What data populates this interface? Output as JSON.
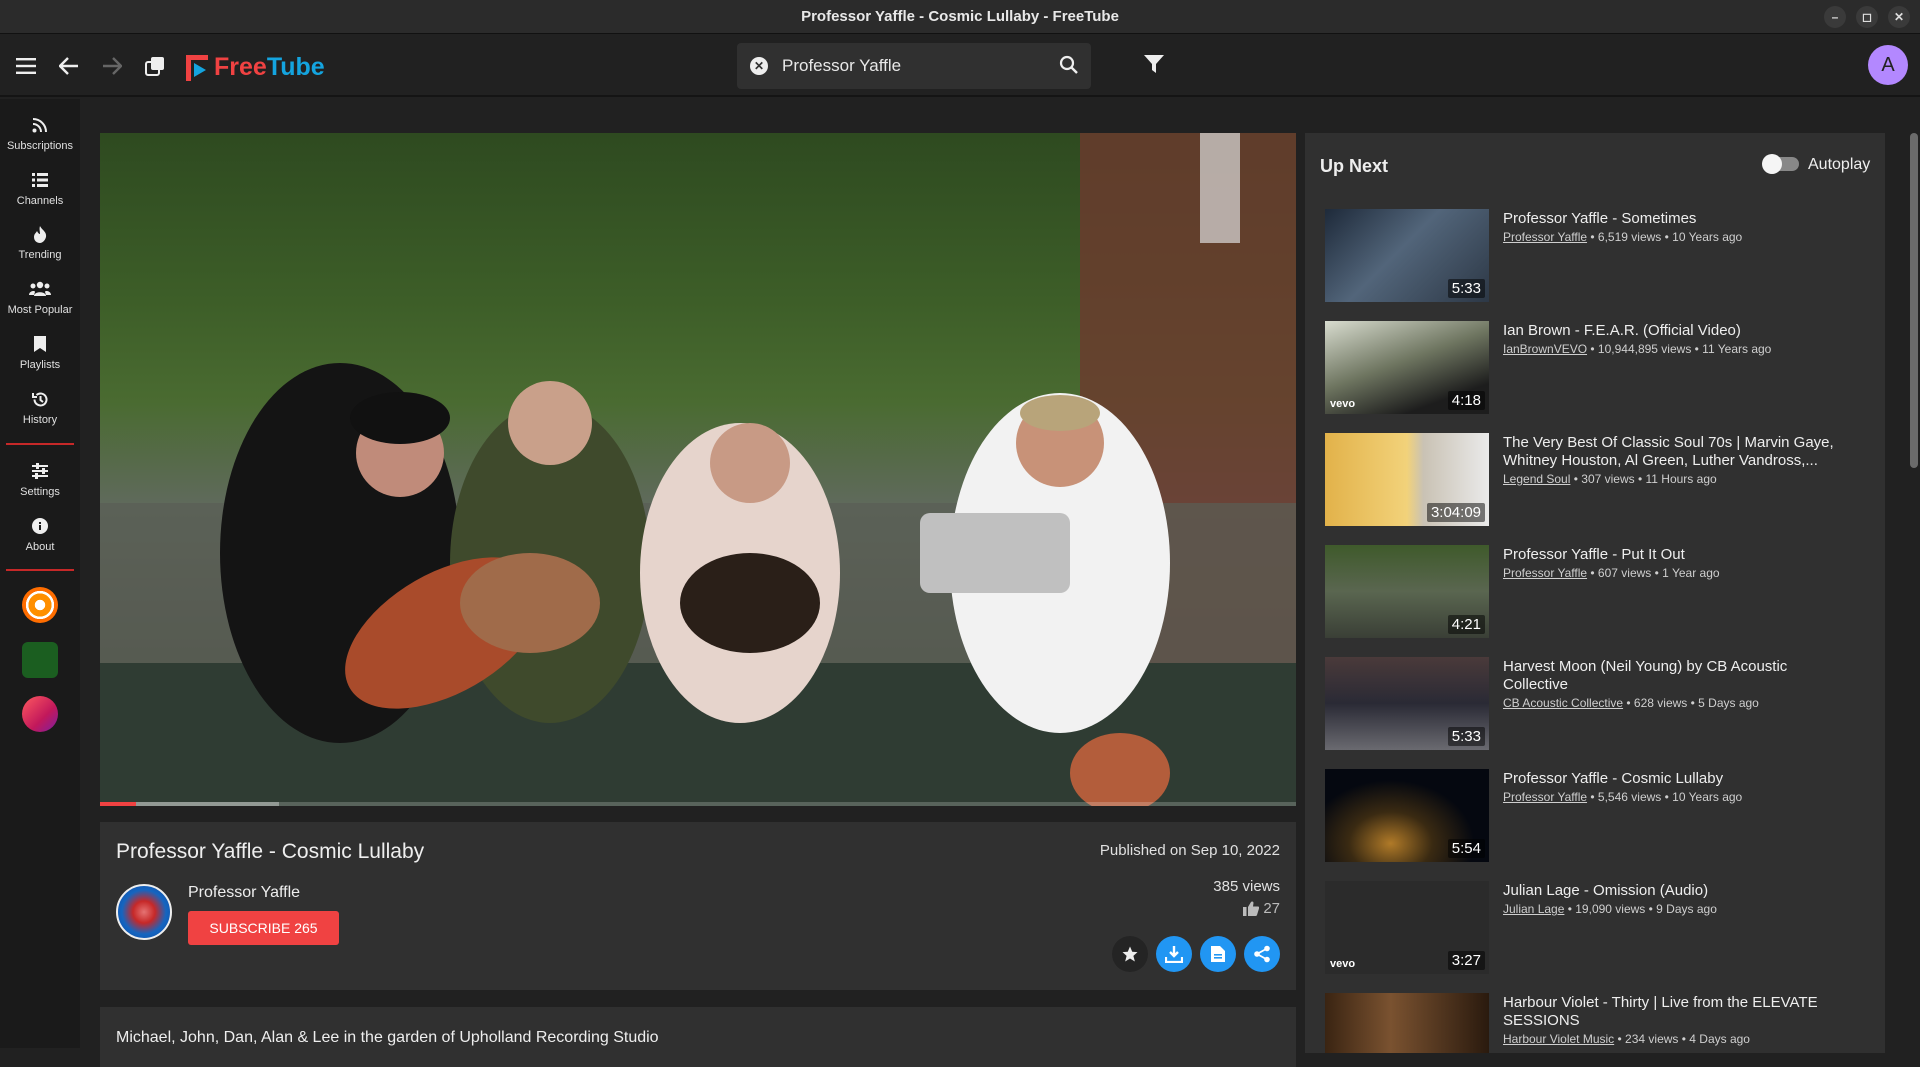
{
  "window": {
    "title": "Professor Yaffle - Cosmic Lullaby - FreeTube"
  },
  "app": {
    "logo_free": "Free",
    "logo_tube": "Tube",
    "avatar_letter": "A"
  },
  "search": {
    "value": "Professor Yaffle"
  },
  "sidebar": {
    "items": [
      {
        "label": "Subscriptions",
        "icon": "rss-icon"
      },
      {
        "label": "Channels",
        "icon": "list-icon"
      },
      {
        "label": "Trending",
        "icon": "fire-icon"
      },
      {
        "label": "Most Popular",
        "icon": "users-icon"
      },
      {
        "label": "Playlists",
        "icon": "bookmark-icon"
      },
      {
        "label": "History",
        "icon": "history-icon"
      },
      {
        "label": "Settings",
        "icon": "sliders-icon"
      },
      {
        "label": "About",
        "icon": "info-icon"
      }
    ]
  },
  "video": {
    "title": "Professor Yaffle - Cosmic Lullaby",
    "published": "Published on Sep 10, 2022",
    "channel": "Professor Yaffle",
    "subscribe_label": "SUBSCRIBE 265",
    "views": "385 views",
    "likes": "27",
    "progress_fraction": 0.03,
    "description": "Michael, John, Dan, Alan & Lee in the garden of Upholland Recording Studio"
  },
  "up_next": {
    "title": "Up Next",
    "autoplay_label": "Autoplay",
    "autoplay_on": false,
    "items": [
      {
        "title": "Professor Yaffle - Sometimes",
        "channel": "Professor Yaffle",
        "meta": " • 6,519 views • 10 Years ago",
        "duration": "5:33",
        "vevo": ""
      },
      {
        "title": "Ian Brown - F.E.A.R. (Official Video)",
        "channel": "IanBrownVEVO",
        "meta": " • 10,944,895 views • 11 Years ago",
        "duration": "4:18",
        "vevo": "vevo"
      },
      {
        "title": "The Very Best Of Classic Soul 70s | Marvin Gaye, Whitney Houston, Al Green, Luther Vandross,...",
        "channel": "Legend Soul",
        "meta": " • 307 views • 11 Hours ago",
        "duration": "3:04:09",
        "vevo": ""
      },
      {
        "title": "Professor Yaffle - Put It Out",
        "channel": "Professor Yaffle",
        "meta": " • 607 views • 1 Year ago",
        "duration": "4:21",
        "vevo": ""
      },
      {
        "title": "Harvest Moon (Neil Young) by CB Acoustic Collective",
        "channel": "CB Acoustic Collective",
        "meta": " • 628 views • 5 Days ago",
        "duration": "5:33",
        "vevo": ""
      },
      {
        "title": "Professor Yaffle - Cosmic Lullaby",
        "channel": "Professor Yaffle",
        "meta": " • 5,546 views • 10 Years ago",
        "duration": "5:54",
        "vevo": ""
      },
      {
        "title": "Julian Lage - Omission (Audio)",
        "channel": "Julian Lage",
        "meta": " • 19,090 views • 9 Days ago",
        "duration": "3:27",
        "vevo": "vevo"
      },
      {
        "title": "Harbour Violet - Thirty | Live from the ELEVATE SESSIONS",
        "channel": "Harbour Violet Music",
        "meta": " • 234 views • 4 Days ago",
        "duration": "",
        "vevo": ""
      }
    ]
  },
  "colors": {
    "accent_red": "#f04242",
    "accent_blue": "#2196f3",
    "logo_blue": "#14a4df"
  }
}
